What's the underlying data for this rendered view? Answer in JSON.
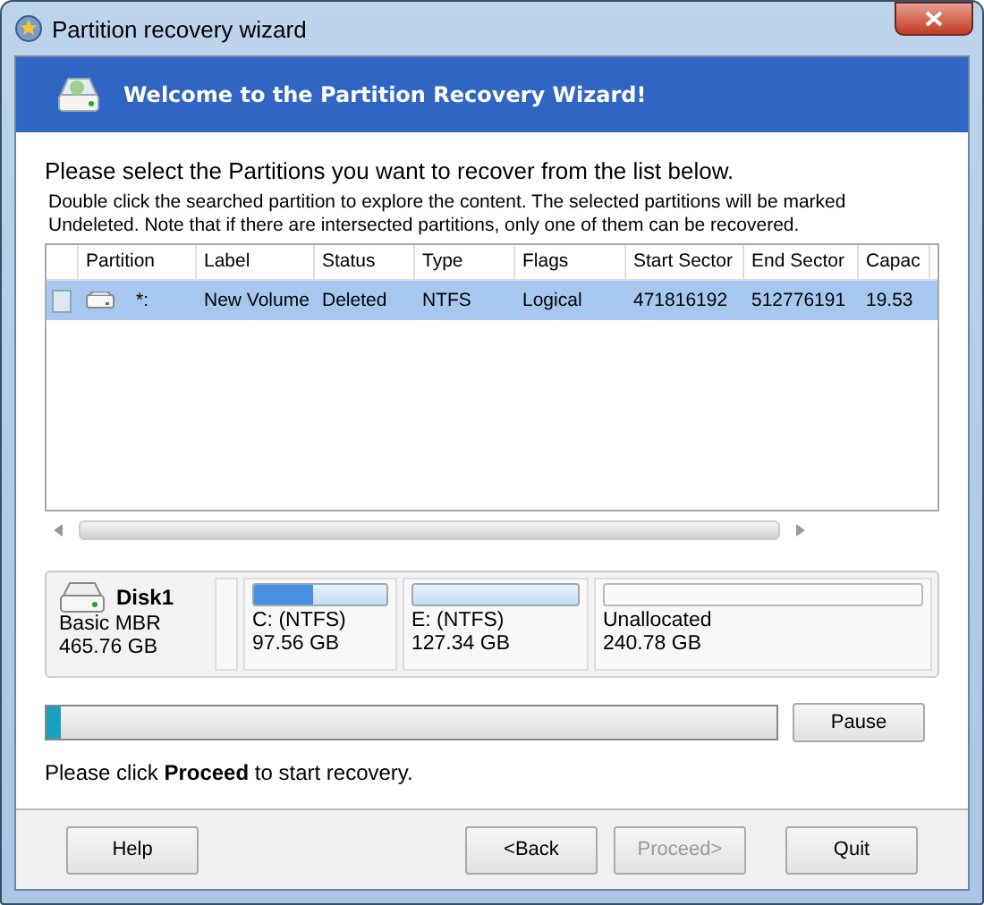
{
  "window": {
    "title": "Partition recovery wizard"
  },
  "header": {
    "title": "Welcome to the Partition Recovery Wizard!"
  },
  "instruction": "Please select the Partitions you want to recover from the list below.",
  "note": "Double click the searched partition to explore the content. The selected partitions will be marked Undeleted. Note that if there are intersected partitions, only one of them can be recovered.",
  "table": {
    "columns": [
      "Partition",
      "Label",
      "Status",
      "Type",
      "Flags",
      "Start Sector",
      "End Sector",
      "Capac"
    ],
    "rows": [
      {
        "selected": true,
        "checked": false,
        "cells": [
          "*:",
          "New Volume",
          "Deleted",
          "NTFS",
          "Logical",
          "471816192",
          "512776191",
          "19.53"
        ]
      }
    ]
  },
  "disk": {
    "name": "Disk1",
    "type": "Basic MBR",
    "size": "465.76 GB",
    "partitions": [
      {
        "kind": "used",
        "name": "C: (NTFS)",
        "size": "97.56 GB",
        "level": 0.45
      },
      {
        "kind": "used",
        "name": "E: (NTFS)",
        "size": "127.34 GB"
      },
      {
        "kind": "free",
        "name": "Unallocated",
        "size": "240.78 GB"
      }
    ]
  },
  "progress": {
    "level": 0.02
  },
  "pause_button": "Pause",
  "status": "Please click **Proceed** to start recovery.",
  "buttons": [
    {
      "label": "Help",
      "disabled": false
    },
    {
      "label": "<Back",
      "disabled": false
    },
    {
      "label": "Proceed>",
      "disabled": true
    },
    {
      "label": "Quit",
      "disabled": false
    }
  ]
}
